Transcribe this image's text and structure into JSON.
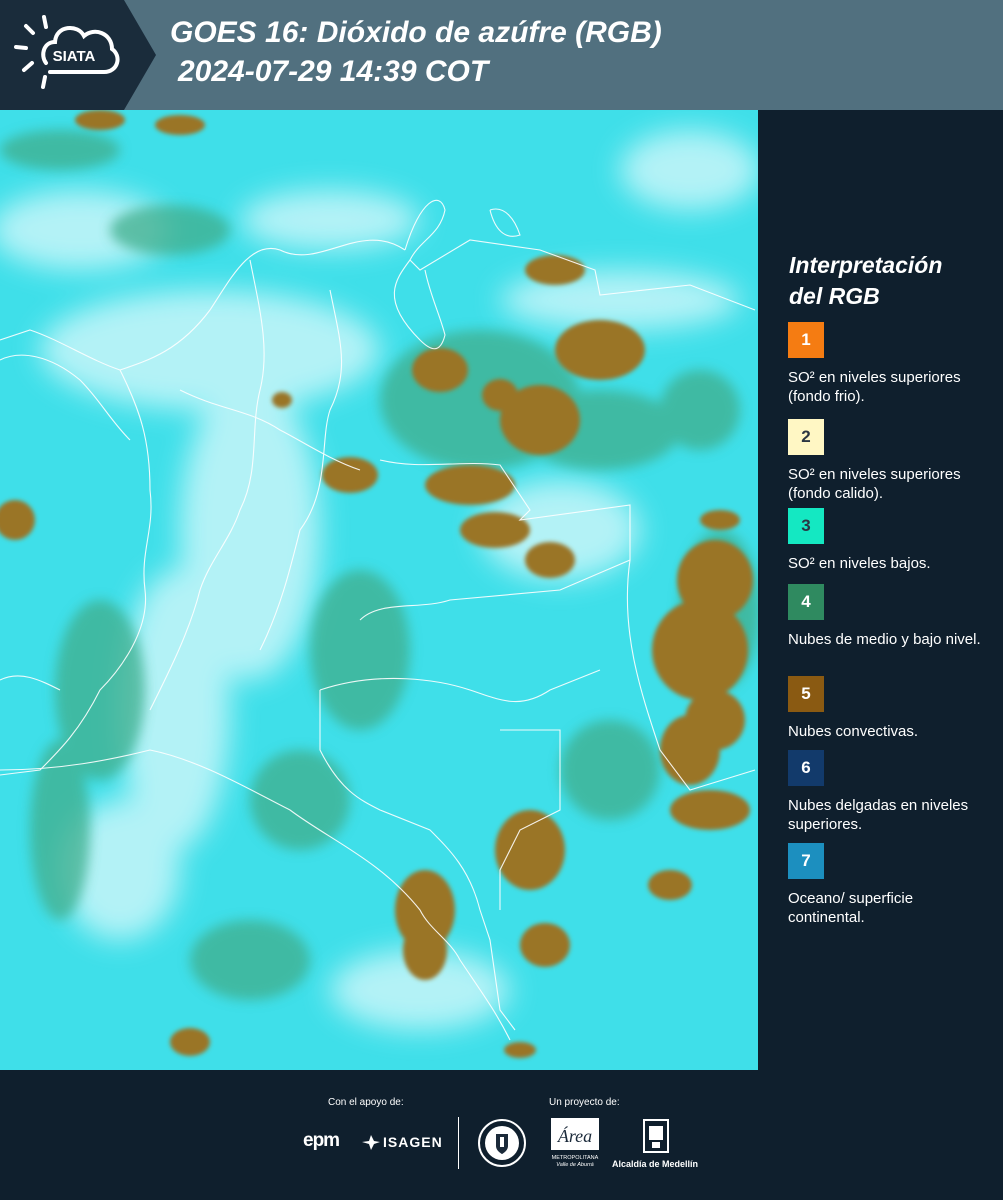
{
  "header": {
    "logo_text": "SIATA",
    "title_line1": "GOES 16: Dióxido de azúfre (RGB)",
    "title_line2": "2024-07-29 14:39 COT"
  },
  "legend": {
    "title_line1": "Interpretación",
    "title_line2": "del RGB",
    "items": [
      {
        "number": "1",
        "color": "#f57c12",
        "number_color": "#ffffff",
        "label": "SO² en niveles superiores (fondo frio)."
      },
      {
        "number": "2",
        "color": "#fff7c4",
        "number_color": "#2b3642",
        "label": "SO² en niveles superiores (fondo calido)."
      },
      {
        "number": "3",
        "color": "#14e8c2",
        "number_color": "#2b3642",
        "label": "SO² en niveles bajos."
      },
      {
        "number": "4",
        "color": "#2f8a60",
        "number_color": "#ffffff",
        "label": "Nubes de medio y bajo nivel."
      },
      {
        "number": "5",
        "color": "#8a5a12",
        "number_color": "#ffffff",
        "label": "Nubes convectivas."
      },
      {
        "number": "6",
        "color": "#123a6b",
        "number_color": "#ffffff",
        "label": "Nubes delgadas en niveles superiores."
      },
      {
        "number": "7",
        "color": "#1c8fbf",
        "number_color": "#ffffff",
        "label": "Oceano/ superficie continental."
      }
    ]
  },
  "map": {
    "background_color": "#3fe2ec",
    "convective_color": "#9a7426",
    "thin_cloud_color": "#cbf7f9",
    "border_color": "#ffffff"
  },
  "footer": {
    "support_label": "Con el apoyo de:",
    "project_label": "Un proyecto de:",
    "sponsor_1": "epm",
    "sponsor_2": "ISAGEN",
    "area_logo_text": "Área",
    "area_sub_1": "METROPOLITANA",
    "area_sub_2": "Valle de Aburrá",
    "alcaldia_text": "Alcaldía de Medellín"
  }
}
